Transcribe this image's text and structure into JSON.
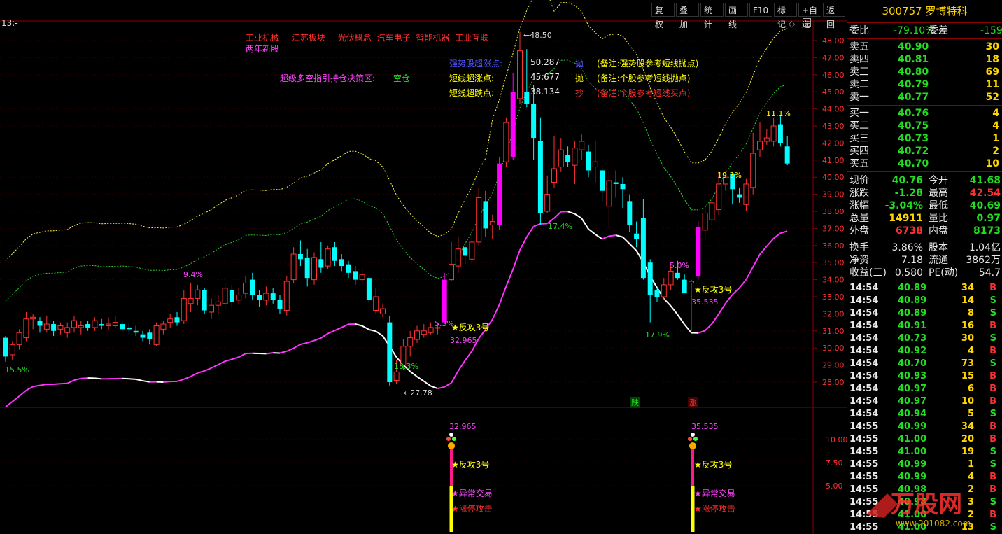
{
  "toolbar": {
    "buttons": [
      "复权",
      "叠加",
      "统计",
      "画线",
      "F10",
      "标记",
      "+自选",
      "返回"
    ],
    "period_label": "13:-"
  },
  "stock": {
    "code": "300757",
    "name": "罗博特科"
  },
  "concept_tags": {
    "row1": [
      "工业机械",
      "江苏板块",
      "光伏概念",
      "汽车电子",
      "智能机器",
      "工业互联"
    ],
    "row2": "两年新股"
  },
  "strategy": {
    "label": "超级多空指引持仓决策区:",
    "value": "空仓"
  },
  "indicator_lines": [
    {
      "label": "强势股超涨点:",
      "value": "50.287",
      "action": "抛",
      "note": "(备注:强势股参考短线抛点)",
      "label_color": "#5555ff",
      "action_color": "#5555ff",
      "note_color": "#ffff00"
    },
    {
      "label": "短线超涨点:",
      "value": "45.677",
      "action": "抛",
      "note": "(备注:个股参考短线抛点)",
      "label_color": "#ffff00",
      "action_color": "#ffff00",
      "note_color": "#ffff00"
    },
    {
      "label": "短线超跌点:",
      "value": "38.134",
      "action": "抄",
      "note": "(备注:个股参考短线买点)",
      "label_color": "#ffff00",
      "action_color": "#ff3030",
      "note_color": "#ff3030"
    }
  ],
  "price_axis": [
    "48.00",
    "47.00",
    "46.00",
    "45.00",
    "44.00",
    "43.00",
    "42.00",
    "41.00",
    "40.00",
    "39.00",
    "38.00",
    "37.00",
    "36.00",
    "35.00",
    "34.00",
    "33.00",
    "32.00",
    "31.00",
    "30.00",
    "29.00",
    "28.00"
  ],
  "sub_axis": [
    "10.00",
    "7.50",
    "5.00"
  ],
  "chart_labels": {
    "high_mark": "48.50",
    "low_mark": "27.78",
    "pct": [
      "15.5%",
      "9.4%",
      "18.3%",
      "5.3%",
      "17.4%",
      "17.9%",
      "5.0%",
      "19.3%",
      "11.1%"
    ],
    "counter1": "反攻3号",
    "counter1_val": "32.965",
    "counter2": "反攻3号",
    "counter2_val": "35.535",
    "badge_fall": "跌",
    "badge_rise": "涨",
    "sub_val1": "32.965",
    "sub_val2": "35.535",
    "sub_sig_a": "反攻3号",
    "sub_sig_b": "异常交易",
    "sub_sig_c": "涨停攻击",
    "sub2_sig_a": "反攻3号",
    "sub2_sig_b": "异常交易",
    "sub2_sig_c": "涨停攻击"
  },
  "colors": {
    "up": "#ff3333",
    "down": "#00ffff",
    "limit": "#ff00ff",
    "bg": "#000000",
    "grid": "#8b0000"
  },
  "quote": {
    "weibi_label": "委比",
    "weibi": "-79.10%",
    "weicha_label": "委差",
    "weicha": "-159",
    "sell": [
      {
        "label": "卖五",
        "price": "40.90",
        "vol": "30"
      },
      {
        "label": "卖四",
        "price": "40.81",
        "vol": "18"
      },
      {
        "label": "卖三",
        "price": "40.80",
        "vol": "69"
      },
      {
        "label": "卖二",
        "price": "40.79",
        "vol": "11"
      },
      {
        "label": "卖一",
        "price": "40.77",
        "vol": "52"
      }
    ],
    "buy": [
      {
        "label": "买一",
        "price": "40.76",
        "vol": "4"
      },
      {
        "label": "买二",
        "price": "40.75",
        "vol": "4"
      },
      {
        "label": "买三",
        "price": "40.73",
        "vol": "1"
      },
      {
        "label": "买四",
        "price": "40.72",
        "vol": "2"
      },
      {
        "label": "买五",
        "price": "40.70",
        "vol": "10"
      }
    ],
    "stats": [
      {
        "l1": "现价",
        "v1": "40.76",
        "c1": "g",
        "l2": "今开",
        "v2": "41.68",
        "c2": "g"
      },
      {
        "l1": "涨跌",
        "v1": "-1.28",
        "c1": "g",
        "l2": "最高",
        "v2": "42.54",
        "c2": "r"
      },
      {
        "l1": "涨幅",
        "v1": "-3.04%",
        "c1": "g",
        "l2": "最低",
        "v2": "40.69",
        "c2": "g"
      },
      {
        "l1": "总量",
        "v1": "14911",
        "c1": "y",
        "l2": "量比",
        "v2": "0.97",
        "c2": "g"
      },
      {
        "l1": "外盘",
        "v1": "6738",
        "c1": "r",
        "l2": "内盘",
        "v2": "8173",
        "c2": "g"
      }
    ],
    "stats2": [
      {
        "l1": "换手",
        "v1": "3.86%",
        "l2": "股本",
        "v2": "1.04亿"
      },
      {
        "l1": "净资",
        "v1": "7.18",
        "l2": "流通",
        "v2": "3862万"
      },
      {
        "l1": "收益(三)",
        "v1": "0.580",
        "l2": "PE(动)",
        "v2": "54.7"
      }
    ]
  },
  "ticks": [
    {
      "t": "14:54",
      "p": "40.89",
      "v": "34",
      "d": "B"
    },
    {
      "t": "14:54",
      "p": "40.89",
      "v": "14",
      "d": "S"
    },
    {
      "t": "14:54",
      "p": "40.89",
      "v": "8",
      "d": "S"
    },
    {
      "t": "14:54",
      "p": "40.91",
      "v": "16",
      "d": "B"
    },
    {
      "t": "14:54",
      "p": "40.73",
      "v": "30",
      "d": "S"
    },
    {
      "t": "14:54",
      "p": "40.92",
      "v": "4",
      "d": "B"
    },
    {
      "t": "14:54",
      "p": "40.70",
      "v": "73",
      "d": "S"
    },
    {
      "t": "14:54",
      "p": "40.93",
      "v": "15",
      "d": "B"
    },
    {
      "t": "14:54",
      "p": "40.97",
      "v": "6",
      "d": "B"
    },
    {
      "t": "14:54",
      "p": "40.97",
      "v": "10",
      "d": "B"
    },
    {
      "t": "14:54",
      "p": "40.94",
      "v": "5",
      "d": "S"
    },
    {
      "t": "14:55",
      "p": "40.99",
      "v": "34",
      "d": "B"
    },
    {
      "t": "14:55",
      "p": "41.00",
      "v": "20",
      "d": "B"
    },
    {
      "t": "14:55",
      "p": "41.00",
      "v": "19",
      "d": "S"
    },
    {
      "t": "14:55",
      "p": "40.99",
      "v": "1",
      "d": "S"
    },
    {
      "t": "14:55",
      "p": "40.99",
      "v": "4",
      "d": "B"
    },
    {
      "t": "14:55",
      "p": "40.98",
      "v": "2",
      "d": "B"
    },
    {
      "t": "14:55",
      "p": "40.98",
      "v": "3",
      "d": "S"
    },
    {
      "t": "14:55",
      "p": "41.00",
      "v": "2",
      "d": "B"
    },
    {
      "t": "14:55",
      "p": "41.00",
      "v": "13",
      "d": "S"
    }
  ],
  "candles": [
    [
      30.6,
      29.5,
      30.7,
      29.2
    ],
    [
      29.6,
      30.2,
      30.4,
      29.3
    ],
    [
      30.2,
      30.9,
      31.1,
      29.9
    ],
    [
      30.6,
      31.7,
      32.1,
      30.4
    ],
    [
      31.7,
      31.8,
      32.0,
      31.1
    ],
    [
      31.6,
      31.3,
      31.8,
      30.9
    ],
    [
      31.1,
      31.4,
      31.9,
      30.9
    ],
    [
      31.4,
      31.0,
      31.6,
      30.7
    ],
    [
      31.1,
      31.3,
      31.5,
      30.8
    ],
    [
      30.9,
      31.2,
      31.5,
      30.6
    ],
    [
      31.2,
      31.6,
      31.9,
      30.9
    ],
    [
      31.2,
      31.3,
      31.6,
      30.8
    ],
    [
      31.4,
      31.2,
      31.6,
      31.0
    ],
    [
      31.2,
      31.6,
      31.8,
      31.0
    ],
    [
      31.4,
      31.3,
      31.7,
      31.1
    ],
    [
      31.3,
      31.4,
      31.8,
      31.1
    ],
    [
      31.3,
      31.5,
      31.9,
      31.2
    ],
    [
      31.4,
      31.1,
      31.6,
      30.9
    ],
    [
      31.2,
      31.1,
      31.5,
      30.8
    ],
    [
      31.0,
      30.9,
      31.3,
      30.7
    ],
    [
      30.8,
      30.6,
      31.0,
      30.4
    ],
    [
      30.9,
      30.5,
      31.1,
      30.2
    ],
    [
      30.2,
      31.3,
      31.5,
      30.1
    ],
    [
      31.1,
      31.4,
      31.6,
      30.8
    ],
    [
      31.5,
      31.7,
      32.0,
      31.2
    ],
    [
      31.8,
      31.5,
      32.1,
      31.3
    ],
    [
      31.6,
      32.9,
      33.4,
      31.4
    ],
    [
      32.6,
      32.9,
      33.8,
      32.1
    ],
    [
      32.9,
      33.4,
      33.7,
      32.5
    ],
    [
      33.4,
      32.2,
      33.5,
      32.0
    ],
    [
      32.1,
      32.5,
      32.9,
      31.7
    ],
    [
      32.5,
      32.7,
      33.1,
      32.0
    ],
    [
      32.6,
      33.5,
      33.8,
      32.2
    ],
    [
      33.4,
      32.7,
      33.7,
      32.4
    ],
    [
      32.8,
      33.1,
      33.5,
      32.6
    ],
    [
      33.2,
      33.8,
      34.2,
      32.9
    ],
    [
      34.0,
      33.1,
      34.4,
      32.8
    ],
    [
      33.1,
      32.8,
      33.4,
      32.4
    ],
    [
      32.8,
      33.2,
      33.6,
      32.5
    ],
    [
      33.2,
      32.8,
      33.5,
      32.6
    ],
    [
      32.8,
      32.3,
      33.1,
      32.0
    ],
    [
      32.2,
      33.9,
      34.2,
      31.9
    ],
    [
      34.0,
      35.5,
      35.9,
      33.8
    ],
    [
      35.5,
      35.2,
      36.3,
      34.8
    ],
    [
      35.3,
      34.1,
      35.8,
      33.6
    ],
    [
      34.0,
      35.3,
      35.6,
      33.7
    ],
    [
      35.2,
      34.7,
      36.2,
      34.4
    ],
    [
      34.8,
      35.8,
      36.0,
      34.6
    ],
    [
      35.9,
      35.1,
      36.2,
      34.8
    ],
    [
      35.2,
      34.8,
      35.5,
      34.5
    ],
    [
      34.9,
      34.4,
      35.1,
      34.1
    ],
    [
      34.5,
      34.0,
      34.8,
      33.7
    ],
    [
      34.0,
      34.3,
      34.7,
      33.7
    ],
    [
      34.1,
      32.8,
      34.2,
      32.7
    ],
    [
      32.2,
      33.0,
      33.5,
      32.0
    ],
    [
      32.0,
      32.3,
      32.6,
      31.8
    ],
    [
      31.5,
      28.0,
      31.9,
      27.8
    ],
    [
      28.1,
      28.6,
      29.3,
      27.9
    ],
    [
      29.0,
      30.1,
      30.5,
      28.7
    ],
    [
      30.1,
      30.6,
      31.0,
      29.5
    ],
    [
      30.5,
      31.0,
      31.3,
      30.3
    ],
    [
      30.8,
      31.0,
      31.4,
      30.6
    ],
    [
      30.9,
      31.2,
      31.5,
      30.8
    ],
    [
      31.2,
      31.2,
      31.5,
      30.8
    ],
    [
      31.5,
      34.0,
      34.4,
      31.4
    ],
    [
      34.0,
      34.9,
      36.2,
      33.9
    ],
    [
      34.8,
      35.8,
      36.5,
      34.4
    ],
    [
      35.9,
      35.4,
      36.3,
      34.9
    ],
    [
      35.2,
      36.2,
      37.0,
      34.9
    ],
    [
      36.2,
      38.8,
      39.4,
      36.0
    ],
    [
      38.6,
      37.0,
      39.2,
      36.5
    ],
    [
      37.2,
      37.4,
      37.8,
      36.4
    ],
    [
      37.2,
      40.8,
      41.2,
      36.9
    ],
    [
      40.9,
      43.2,
      43.5,
      40.6
    ],
    [
      41.2,
      45.0,
      46.1,
      41.0
    ],
    [
      44.6,
      47.4,
      48.5,
      44.3
    ],
    [
      45.0,
      44.3,
      47.5,
      44.1
    ],
    [
      44.3,
      42.3,
      45.4,
      41.0
    ],
    [
      42.1,
      37.9,
      43.5,
      37.2
    ],
    [
      38.0,
      39.0,
      40.1,
      37.9
    ],
    [
      39.7,
      40.5,
      42.4,
      39.4
    ],
    [
      40.6,
      41.6,
      42.3,
      40.3
    ],
    [
      41.3,
      40.9,
      41.8,
      40.6
    ],
    [
      40.7,
      41.7,
      42.1,
      39.6
    ],
    [
      41.6,
      42.1,
      42.5,
      41.0
    ],
    [
      41.5,
      40.4,
      41.9,
      40.0
    ],
    [
      40.6,
      40.9,
      42.1,
      39.7
    ],
    [
      40.4,
      39.2,
      40.6,
      38.6
    ],
    [
      38.3,
      39.8,
      40.4,
      37.0
    ],
    [
      39.7,
      39.6,
      40.4,
      38.8
    ],
    [
      39.6,
      39.3,
      40.0,
      38.2
    ],
    [
      38.6,
      37.2,
      39.0,
      36.8
    ],
    [
      36.7,
      36.4,
      37.4,
      35.9
    ],
    [
      37.6,
      34.1,
      38.7,
      34.0
    ],
    [
      35.0,
      33.1,
      35.2,
      31.5
    ],
    [
      33.4,
      33.0,
      33.5,
      32.7
    ],
    [
      33.0,
      33.7,
      34.1,
      32.8
    ],
    [
      33.7,
      34.5,
      34.9,
      33.4
    ],
    [
      34.4,
      34.1,
      35.1,
      34.0
    ],
    [
      34.0,
      33.2,
      34.3,
      33.2
    ],
    [
      33.8,
      33.9,
      34.0,
      31.0
    ],
    [
      34.2,
      37.1,
      37.4,
      34.0
    ],
    [
      36.9,
      37.9,
      38.4,
      36.4
    ],
    [
      37.5,
      38.5,
      38.8,
      37.2
    ],
    [
      38.1,
      39.6,
      40.2,
      37.8
    ],
    [
      39.6,
      40.0,
      40.2,
      39.2
    ],
    [
      40.2,
      39.3,
      40.3,
      38.4
    ],
    [
      39.0,
      38.8,
      39.4,
      38.5
    ],
    [
      38.4,
      39.6,
      39.9,
      38.0
    ],
    [
      39.4,
      41.4,
      42.6,
      39.0
    ],
    [
      41.6,
      42.1,
      43.2,
      41.2
    ],
    [
      42.1,
      42.3,
      42.8,
      41.9
    ],
    [
      42.1,
      43.0,
      43.5,
      41.8
    ],
    [
      43.1,
      42.0,
      43.6,
      41.8
    ],
    [
      41.8,
      40.8,
      42.4,
      40.7
    ]
  ]
}
